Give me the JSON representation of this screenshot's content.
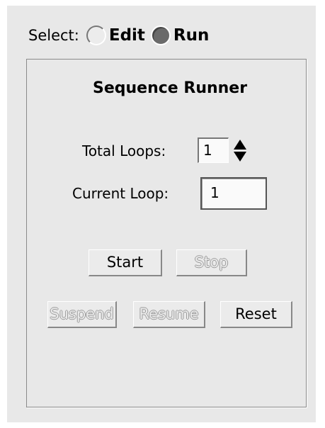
{
  "select": {
    "label": "Select:",
    "options": [
      {
        "label": "Edit",
        "selected": false
      },
      {
        "label": "Run",
        "selected": true
      }
    ]
  },
  "runner": {
    "title": "Sequence Runner",
    "total_loops_label": "Total Loops:",
    "total_loops_value": "1",
    "current_loop_label": "Current Loop:",
    "current_loop_value": "1"
  },
  "buttons": {
    "start": "Start",
    "stop": "Stop",
    "suspend": "Suspend",
    "resume": "Resume",
    "reset": "Reset"
  },
  "button_state": {
    "start_enabled": true,
    "stop_enabled": false,
    "suspend_enabled": false,
    "resume_enabled": false,
    "reset_enabled": true
  }
}
